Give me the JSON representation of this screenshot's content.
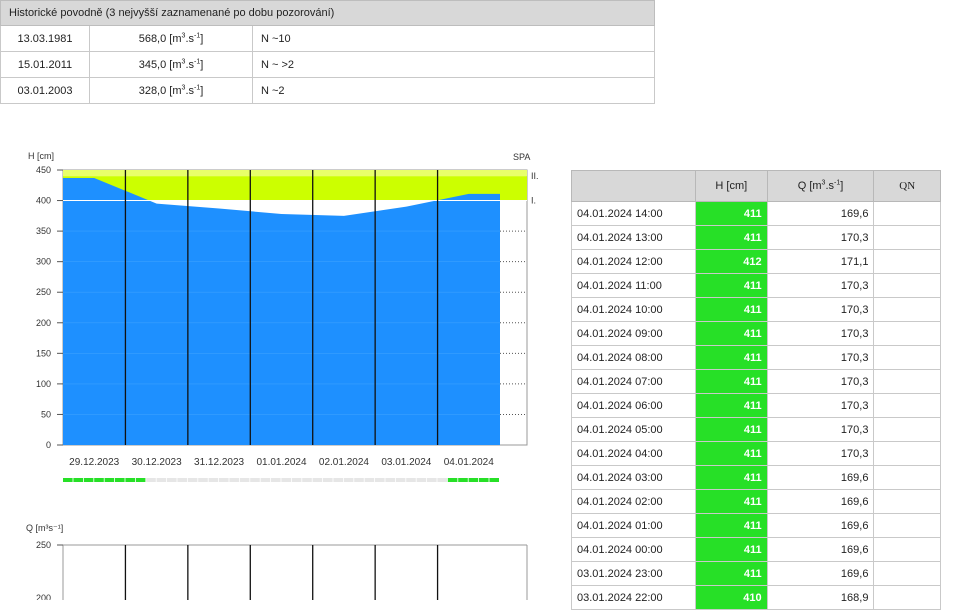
{
  "historic": {
    "title": "Historické povodně (3 nejvyšší zaznamenané po dobu pozorování)",
    "rows": [
      {
        "date": "13.03.1981",
        "q": "568,0",
        "n": "N ~10"
      },
      {
        "date": "15.01.2011",
        "q": "345,0",
        "n": "N ~ >2"
      },
      {
        "date": "03.01.2003",
        "q": "328,0",
        "n": "N ~2"
      }
    ],
    "unit_prefix": "[m",
    "unit_sup1": "3",
    "unit_mid": ".s",
    "unit_sup2": "-1",
    "unit_suffix": "]"
  },
  "chart_h": {
    "unit": "H [cm]",
    "spa": "SPA",
    "spa_levels": [
      "II.",
      "I."
    ],
    "yticks": [
      "450",
      "400",
      "350",
      "300",
      "250",
      "200",
      "150",
      "100",
      "50",
      "0"
    ],
    "dates": [
      "29.12.2023",
      "30.12.2023",
      "31.12.2023",
      "01.01.2024",
      "02.01.2024",
      "03.01.2024",
      "04.01.2024"
    ]
  },
  "chart_q": {
    "unit": "Q [m³s⁻¹]",
    "yticks": [
      "250",
      "200"
    ]
  },
  "chart_data": {
    "type": "area",
    "ylabel": "H [cm]",
    "ylim": [
      0,
      450
    ],
    "x": [
      "29.12.2023",
      "30.12.2023",
      "31.12.2023",
      "01.01.2024",
      "02.01.2024",
      "03.01.2024",
      "04.01.2024"
    ],
    "series": [
      {
        "values": [
          437,
          395,
          387,
          378,
          375,
          390,
          411
        ]
      }
    ],
    "thresholds": {
      "I.": 400,
      "II.": 440
    },
    "grid": true
  },
  "table": {
    "headers": [
      "",
      "H [cm]",
      "Q [m",
      "QN"
    ],
    "qh_sup": "3",
    "qh_mid": ".s",
    "qh_sup2": "-1",
    "qh_end": "]",
    "rows": [
      {
        "t": "04.01.2024 14:00",
        "h": "411",
        "q": "169,6"
      },
      {
        "t": "04.01.2024 13:00",
        "h": "411",
        "q": "170,3"
      },
      {
        "t": "04.01.2024 12:00",
        "h": "412",
        "q": "171,1"
      },
      {
        "t": "04.01.2024 11:00",
        "h": "411",
        "q": "170,3"
      },
      {
        "t": "04.01.2024 10:00",
        "h": "411",
        "q": "170,3"
      },
      {
        "t": "04.01.2024 09:00",
        "h": "411",
        "q": "170,3"
      },
      {
        "t": "04.01.2024 08:00",
        "h": "411",
        "q": "170,3"
      },
      {
        "t": "04.01.2024 07:00",
        "h": "411",
        "q": "170,3"
      },
      {
        "t": "04.01.2024 06:00",
        "h": "411",
        "q": "170,3"
      },
      {
        "t": "04.01.2024 05:00",
        "h": "411",
        "q": "170,3"
      },
      {
        "t": "04.01.2024 04:00",
        "h": "411",
        "q": "170,3"
      },
      {
        "t": "04.01.2024 03:00",
        "h": "411",
        "q": "169,6"
      },
      {
        "t": "04.01.2024 02:00",
        "h": "411",
        "q": "169,6"
      },
      {
        "t": "04.01.2024 01:00",
        "h": "411",
        "q": "169,6"
      },
      {
        "t": "04.01.2024 00:00",
        "h": "411",
        "q": "169,6"
      },
      {
        "t": "03.01.2024 23:00",
        "h": "411",
        "q": "169,6"
      },
      {
        "t": "03.01.2024 22:00",
        "h": "410",
        "q": "168,9"
      }
    ]
  },
  "colors": {
    "water": "#1e90ff",
    "spa": "#ccff00",
    "green": "#27e027"
  }
}
